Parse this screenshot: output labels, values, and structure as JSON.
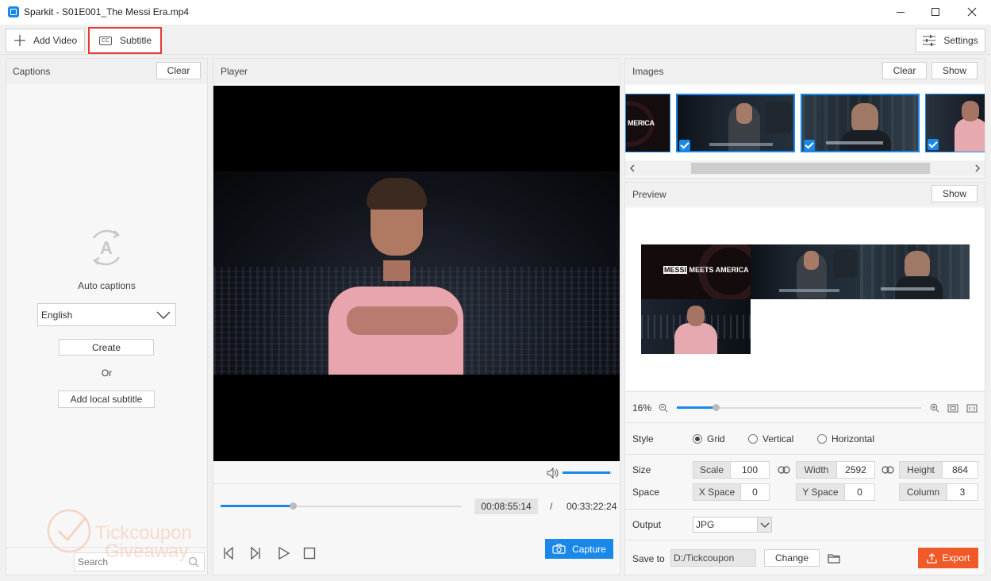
{
  "window": {
    "title": "Sparkit - S01E001_The Messi Era.mp4"
  },
  "toolbar": {
    "add_video": "Add Video",
    "subtitle": "Subtitle",
    "settings": "Settings"
  },
  "captions": {
    "title": "Captions",
    "clear": "Clear",
    "auto_label": "Auto captions",
    "language": "English",
    "create": "Create",
    "or": "Or",
    "add_local": "Add local subtitle",
    "search_placeholder": "Search"
  },
  "player": {
    "title": "Player",
    "current_time": "00:08:55:14",
    "separator": "/",
    "total_time": "00:33:22:24",
    "capture": "Capture",
    "progress": 0.3,
    "volume": 0.97
  },
  "images": {
    "title": "Images",
    "clear": "Clear",
    "show": "Show",
    "thumb1_text": "MERICA"
  },
  "preview": {
    "title": "Preview",
    "show": "Show",
    "zoom": "16%",
    "zoom_level": 0.16,
    "tile1_text1": "MESSI",
    "tile1_text2": " MEETS AMERICA"
  },
  "style": {
    "label": "Style",
    "options": [
      "Grid",
      "Vertical",
      "Horizontal"
    ],
    "selected": "Grid"
  },
  "size": {
    "label": "Size",
    "scale_label": "Scale",
    "scale": "100",
    "width_label": "Width",
    "width": "2592",
    "height_label": "Height",
    "height": "864"
  },
  "space": {
    "label": "Space",
    "x_label": "X Space",
    "x": "0",
    "y_label": "Y Space",
    "y": "0",
    "column_label": "Column",
    "column": "3"
  },
  "output": {
    "label": "Output",
    "format": "JPG"
  },
  "save": {
    "label": "Save to",
    "path": "D:/Tickcoupon",
    "change": "Change",
    "export": "Export"
  },
  "watermark": {
    "line1": "Tickcoupon",
    "line2": "Giveaway"
  },
  "colors": {
    "accent": "#1a88e8",
    "export": "#f05a28",
    "highlight": "#e53935"
  }
}
